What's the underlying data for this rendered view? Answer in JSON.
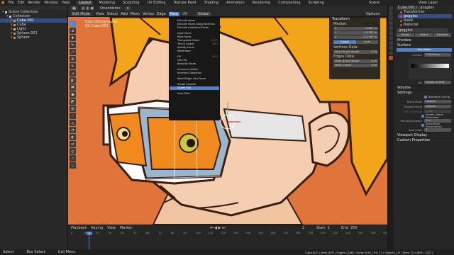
{
  "topbar": {
    "menus": [
      "File",
      "Edit",
      "Render",
      "Window",
      "Help"
    ],
    "workspaces": [
      "Layout",
      "Modeling",
      "Sculpting",
      "UV Editing",
      "Texture Paint",
      "Shading",
      "Animation",
      "Rendering",
      "Compositing",
      "Scripting"
    ],
    "scene": "Scene",
    "view_layer": "View Layer"
  },
  "outliner": {
    "rows": [
      {
        "label": "Scene Collection",
        "color": "#cfcfcf",
        "sel": false,
        "indent": 0
      },
      {
        "label": "Collection",
        "color": "#cfcfcf",
        "sel": false,
        "indent": 1
      },
      {
        "label": "Cube.001",
        "color": "#e08a3c",
        "sel": true,
        "indent": 2
      },
      {
        "label": "Cube",
        "color": "#e08a3c",
        "sel": false,
        "indent": 2
      },
      {
        "label": "Light",
        "color": "#d4c86a",
        "sel": false,
        "indent": 2
      },
      {
        "label": "Sphere.001",
        "color": "#e08a3c",
        "sel": false,
        "indent": 2
      },
      {
        "label": "Sphere",
        "color": "#e08a3c",
        "sel": false,
        "indent": 2
      }
    ]
  },
  "viewport_header": {
    "mode": "Edit Mode",
    "menus": [
      "View",
      "Select",
      "Add",
      "Mesh",
      "Vertex",
      "Edge",
      "Face",
      "UV"
    ],
    "active_menu": "Face",
    "orientation": "Global",
    "options": "Options"
  },
  "viewport_info": {
    "line1": "User Orthographic",
    "line2": "(0) Cube.001"
  },
  "face_menu": {
    "items": [
      {
        "label": "Extrude Faces",
        "shortcut": "",
        "sep": false
      },
      {
        "label": "Extrude Faces Along Normals",
        "shortcut": "",
        "sep": false
      },
      {
        "label": "Extrude Individual Faces",
        "shortcut": "",
        "sep": false
      },
      {
        "label": "Inset Faces",
        "shortcut": "",
        "sep": true
      },
      {
        "label": "Poke Faces",
        "shortcut": "",
        "sep": false
      },
      {
        "label": "Triangulate Faces",
        "shortcut": "Ctrl T",
        "sep": false
      },
      {
        "label": "Tris to Quads",
        "shortcut": "Alt J",
        "sep": false
      },
      {
        "label": "Solidify Faces",
        "shortcut": "",
        "sep": false
      },
      {
        "label": "Wireframe",
        "shortcut": "",
        "sep": false
      },
      {
        "label": "Fill",
        "shortcut": "Alt F",
        "sep": true
      },
      {
        "label": "Grid Fill",
        "shortcut": "",
        "sep": false
      },
      {
        "label": "Beautify Faces",
        "shortcut": "",
        "sep": false
      },
      {
        "label": "Intersect (Knife)",
        "shortcut": "",
        "sep": true
      },
      {
        "label": "Intersect (Boolean)",
        "shortcut": "",
        "sep": false
      },
      {
        "label": "Weld Edges into Faces",
        "shortcut": "",
        "sep": true
      },
      {
        "label": "Shade Smooth",
        "shortcut": "",
        "sep": true
      },
      {
        "label": "Shade Flat",
        "shortcut": "",
        "sep": false,
        "hl": true
      },
      {
        "label": "Face Data",
        "shortcut": "",
        "sep": true
      }
    ]
  },
  "npanel": {
    "transform_title": "Transform",
    "median_label": "Median:",
    "median": [
      {
        "axis": "X",
        "value": "1.0667 m"
      },
      {
        "axis": "Y",
        "value": "-0.4363 m"
      },
      {
        "axis": "Z",
        "value": "0.12999 m"
      }
    ],
    "tabs": [
      "Global",
      "Local"
    ],
    "vertices_data": "Vertices Data:",
    "mean_bevel_weight_label": "Mean Bevel Weight",
    "mean_bevel_weight": "0.00",
    "edges_data": "Edges Data:",
    "edge_bevel_weight_label": "Mean Bevel Weight",
    "edge_bevel_weight": "0.00",
    "mean_crease_label": "Mean Crease",
    "mean_crease": "0.00"
  },
  "timeline": {
    "menus": [
      "Playback",
      "Keying",
      "View",
      "Marker"
    ],
    "frame_current": "2",
    "start_label": "Start",
    "start": "1",
    "end_label": "End",
    "end": "250",
    "ruler": [
      "0",
      "10",
      "20",
      "30",
      "40",
      "50",
      "60",
      "70",
      "80",
      "90",
      "100",
      "110",
      "120",
      "130",
      "140",
      "150",
      "160",
      "170",
      "180",
      "190",
      "200",
      "210",
      "220",
      "230",
      "240",
      "250"
    ]
  },
  "statusbar": {
    "items": [
      "Select",
      "Box Select",
      "Call Menu"
    ],
    "stats": "Cube.001 | Verts 8/53 | Edges 12/88 | Faces 6/36 | Tris 72 | Objects 1/5 | Mem 33.4 MiB | 2.82.7"
  },
  "properties": {
    "slots": [
      {
        "label": "Transformer",
        "sel": false
      },
      {
        "label": "goggles",
        "sel": true
      },
      {
        "label": "black",
        "sel": false
      },
      {
        "label": "Material",
        "sel": false
      }
    ],
    "material_name": "goggles",
    "buttons": [
      "Assign",
      "Select",
      "Deselect"
    ],
    "preview": "Preview",
    "surface_section": "Surface",
    "use_nodes": "Use Nodes",
    "surface_label": "Surface",
    "surface_value": "ColorRamp",
    "fac_label": "Fac",
    "fac_value": "Shader to RGB",
    "volume": "Volume",
    "settings": "Settings",
    "backface_culling": "Backface Culling",
    "blend_mode_label": "Blend Mode",
    "blend_mode": "Opaque",
    "shadow_mode_label": "Shadow Mode",
    "shadow_mode": "Opaque",
    "clip_threshold_label": "Clip Threshold",
    "clip_threshold": "0.500",
    "screen_space_refraction": "Screen Space Refraction",
    "refraction_depth_label": "Refraction Depth",
    "refraction_depth": "0 m",
    "subsurface_translucency": "Subsurface Translucency",
    "pass_index_label": "Pass Index",
    "pass_index": "0",
    "viewport_display": "Viewport Display",
    "custom_properties": "Custom Properties"
  },
  "colors": {
    "accent": "#5680c2",
    "hair": "#f2a51a",
    "skin": "#f3c8a8",
    "outline": "#3a1e12",
    "goggle_lens": "#f08a1e"
  }
}
